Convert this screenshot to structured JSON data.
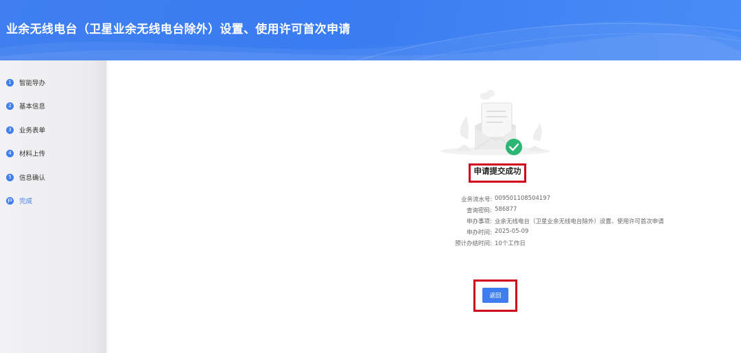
{
  "header": {
    "title": "业余无线电台（卫星业余无线电台除外）设置、使用许可首次申请"
  },
  "sidebar": {
    "steps": [
      {
        "num": "1",
        "label": "智能导办"
      },
      {
        "num": "2",
        "label": "基本信息"
      },
      {
        "num": "3",
        "label": "业务表单"
      },
      {
        "num": "4",
        "label": "材料上传"
      },
      {
        "num": "5",
        "label": "信息确认"
      },
      {
        "num": "",
        "label": "完成",
        "active": true
      }
    ]
  },
  "result": {
    "title": "申请提交成功",
    "fields": [
      {
        "key": "业务流水号:",
        "value": "009501108504197"
      },
      {
        "key": "查询密码:",
        "value": "586877"
      },
      {
        "key": "申办事项:",
        "value": "业余无线电台（卫星业余无线电台除外）设置、使用许可首次申请"
      },
      {
        "key": "申办时间:",
        "value": "2025-05-09"
      },
      {
        "key": "预计办结时间:",
        "value": "10个工作日"
      }
    ],
    "back_label": "返回"
  },
  "colors": {
    "primary": "#3e7ef0",
    "success": "#2bb673",
    "highlight": "#d0021b"
  }
}
